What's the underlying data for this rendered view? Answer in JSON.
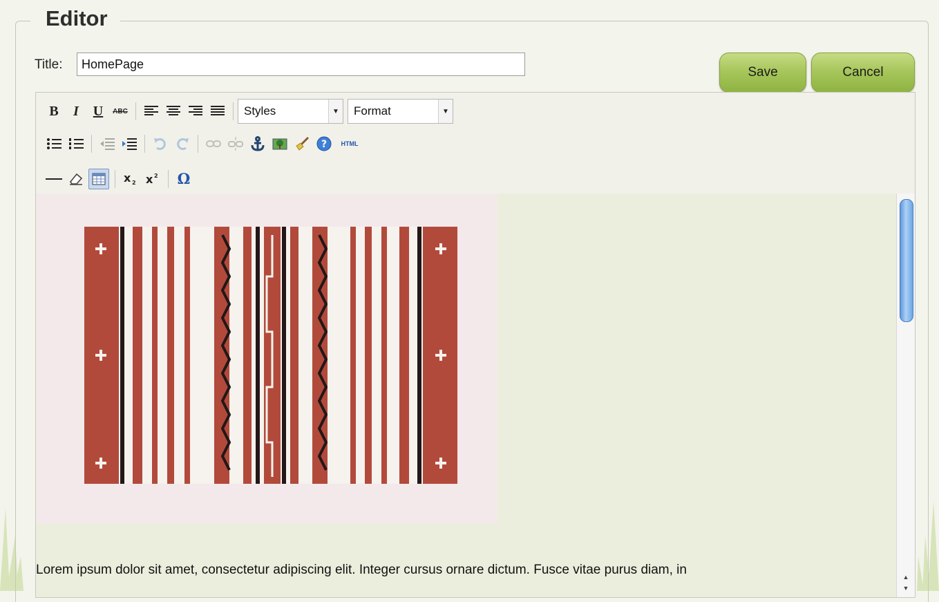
{
  "editor": {
    "legend": "Editor",
    "title_label": "Title:",
    "title_value": "HomePage",
    "save_label": "Save",
    "cancel_label": "Cancel"
  },
  "toolbar": {
    "row1": [
      "bold-icon",
      "italic-icon",
      "underline-icon",
      "strikethrough-icon",
      "align-left-icon",
      "align-center-icon",
      "align-right-icon",
      "align-justify-icon"
    ],
    "styles_value": "Styles",
    "format_value": "Format",
    "row2": [
      "bullet-list-icon",
      "numbered-list-icon",
      "outdent-icon",
      "indent-icon",
      "undo-icon",
      "redo-icon",
      "link-icon",
      "unlink-icon",
      "anchor-icon",
      "image-icon",
      "cleanup-icon",
      "help-icon",
      "html-icon"
    ],
    "html_label": "HTML",
    "row3": [
      "horizontal-rule-icon",
      "eraser-icon",
      "table-icon",
      "subscript-icon",
      "superscript-icon",
      "omega-icon"
    ]
  },
  "content": {
    "paragraph": "Lorem ipsum dolor sit amet, consectetur adipiscing elit. Integer cursus ornare dictum. Fusce vitae purus diam, in"
  },
  "colors": {
    "button_green": "#a6c55a",
    "rug_red": "#b24a3c",
    "scroll_blue": "#5e98dc"
  }
}
